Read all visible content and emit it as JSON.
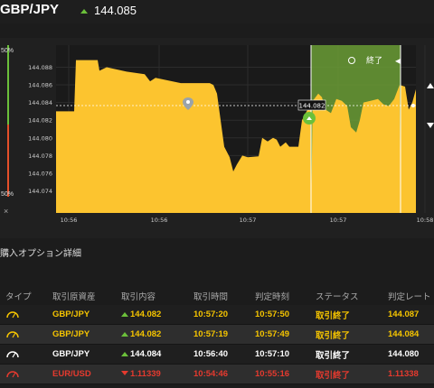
{
  "header": {
    "pair": "GBP/JPY",
    "price": "144.085",
    "trend": "up"
  },
  "chart": {
    "percent_top": "50%",
    "percent_bottom": "50%",
    "close_label": "終了",
    "current_price_tag": "144.082",
    "sidebar_close": "×",
    "colors": {
      "area": "#fcc42f",
      "expiry_zone": "#6b9e36",
      "up": "#6bc03a",
      "down": "#e5502a"
    }
  },
  "chart_data": {
    "type": "area",
    "title": "",
    "xlabel": "",
    "ylabel": "",
    "x_ticks": [
      "10:56",
      "10:56",
      "10:57",
      "10:57",
      "10:58"
    ],
    "y_ticks": [
      "144.088",
      "144.086",
      "144.084",
      "144.082",
      "144.080",
      "144.078",
      "144.076",
      "144.074"
    ],
    "ylim": [
      144.0715,
      144.0905
    ],
    "values": [
      144.0828,
      144.0828,
      144.0828,
      144.0828,
      144.0828,
      144.0828,
      144.0828,
      144.0828,
      144.0828,
      144.0828,
      144.0828,
      144.0828,
      144.0828,
      144.0828,
      144.0828,
      144.0828,
      144.0828,
      144.0828,
      144.0828,
      144.0882,
      144.0882,
      144.0882,
      144.0882,
      144.0882,
      144.0882,
      144.0882,
      144.0878,
      144.0878,
      144.0878,
      144.0878,
      144.0878,
      144.0878,
      144.0878,
      144.0878,
      144.0878,
      144.0878,
      144.0878,
      144.0878,
      144.0878,
      144.0878,
      144.0878,
      144.0878,
      144.0878,
      144.0878,
      144.0878,
      144.0878,
      144.0878,
      144.0878,
      144.0878,
      144.0878,
      144.0878,
      144.0878,
      144.0878,
      144.0878,
      144.0878,
      144.0878,
      144.0878,
      144.0878,
      144.0878,
      144.0878,
      144.0878,
      144.0878,
      144.0878,
      144.0878,
      144.0878,
      144.0878,
      144.0878,
      144.0878,
      144.0878,
      144.0878,
      144.0878,
      144.0878,
      144.0878,
      144.0878,
      144.0878,
      144.0878,
      144.0878,
      144.0878,
      144.0878,
      144.0878,
      144.0878,
      144.0878,
      144.0878,
      144.0878,
      144.0878,
      144.0878,
      144.0878,
      144.0878,
      144.0878,
      144.0878,
      144.0878,
      144.0878,
      144.0878,
      144.0878,
      144.0878,
      144.0878,
      144.0878,
      144.0878,
      144.0878,
      144.0878,
      144.0855,
      144.0855,
      144.0855,
      144.0855,
      144.0855,
      144.0855,
      144.0855,
      144.0855,
      144.0855,
      144.0855,
      144.0855,
      144.0855,
      144.0855,
      144.0855,
      144.0855,
      144.0855,
      144.0855,
      144.0855,
      144.0855,
      144.0855,
      144.0855,
      144.0855,
      144.0855,
      144.0855,
      144.0855,
      144.0855,
      144.0855,
      144.0855,
      144.0855,
      144.0855,
      144.0855,
      144.0855,
      144.0855,
      144.0855,
      144.0855,
      144.0855,
      144.0855,
      144.0855,
      144.0855,
      144.0855,
      144.0855,
      144.0855,
      144.0855,
      144.0855,
      144.0855,
      144.0855,
      144.0855,
      144.0838,
      144.0838,
      144.0838,
      144.0838,
      144.0838,
      144.0838,
      144.0838,
      144.0848,
      144.0848,
      144.0848,
      144.0848,
      144.0848,
      144.0848,
      144.0848,
      144.0848,
      144.0848,
      144.0848,
      144.0848,
      144.0848,
      144.0848,
      144.0848,
      144.0848,
      144.0848,
      144.0848,
      144.0848,
      144.0848,
      144.0848,
      144.0838,
      144.0838,
      144.0838,
      144.0838,
      144.0838,
      144.0838,
      144.0838,
      144.0838,
      144.0848,
      144.0848,
      144.0848,
      144.0848,
      144.0848,
      144.0848,
      144.0848,
      144.0848,
      144.0848,
      144.0848,
      144.0848,
      144.0848,
      144.0848,
      144.0848,
      144.0848,
      144.0848,
      144.0848,
      144.0848,
      144.0848,
      144.0848,
      144.0848,
      144.0848,
      144.0848,
      144.0848,
      144.0848,
      144.0848,
      144.0848,
      144.0848,
      144.0848,
      144.0848,
      144.0848,
      144.0848,
      144.0848,
      144.0848,
      144.0848,
      144.0848,
      144.0848,
      144.0848,
      144.0848,
      144.0848,
      144.0848,
      144.0848,
      144.0848,
      144.0848,
      144.0848,
      144.0848,
      144.0848,
      144.0848,
      144.0848,
      144.0848,
      144.0848,
      144.0848,
      144.0848,
      144.0848,
      144.0848,
      144.0848,
      144.0848,
      144.0848,
      144.0848,
      144.0848,
      144.0848,
      144.0848,
      144.0848,
      144.0848,
      144.0848,
      144.0848,
      144.0848,
      144.0848,
      144.0848,
      144.0848,
      144.0848,
      144.0848,
      144.0848,
      144.0848,
      144.0848,
      144.0848,
      144.0848,
      144.0848,
      144.0848,
      144.0848,
      144.0848,
      144.0848,
      144.0848,
      144.0848,
      144.0848,
      144.0848,
      144.0848,
      144.0848,
      144.0848,
      144.0848,
      144.0848,
      144.0848,
      144.0848,
      144.0848,
      144.0848,
      144.0848,
      144.0848,
      144.0848,
      144.0848,
      144.0848,
      144.0848,
      144.0848,
      144.0848,
      144.0848,
      144.0848,
      144.0848,
      144.0848,
      144.0848,
      144.0848,
      144.0848,
      144.0848,
      144.0848,
      144.0848,
      144.0848,
      144.0848,
      144.0848,
      144.0848,
      144.0848,
      144.0848,
      144.0848,
      144.0848,
      144.0848,
      144.0848,
      144.0848,
      144.0848,
      144.0848,
      144.0848,
      144.0848,
      144.0848,
      144.0848,
      144.0848,
      144.0848,
      144.0848,
      144.0848,
      144.0848,
      144.0848,
      144.0848,
      144.0848,
      144.0848,
      144.0848,
      144.0848,
      144.0848,
      144.0848,
      144.0848,
      144.0848,
      144.0848,
      144.0848,
      144.0848,
      144.0848,
      144.0848,
      144.0848,
      144.0848,
      144.0848,
      144.0848,
      144.0848,
      144.0848,
      144.0848,
      144.0848,
      144.0848,
      144.0848,
      144.0848,
      144.0848,
      144.0848,
      144.0848,
      144.0848,
      144.0848,
      144.0848,
      144.0848,
      144.0848,
      144.0848,
      144.0848,
      144.0848
    ],
    "grid": true,
    "legend": "none"
  },
  "details": {
    "title": "購入オプション詳細"
  },
  "table": {
    "headers": [
      "タイプ",
      "取引原資産",
      "取引内容",
      "取引時間",
      "判定時刻",
      "ステータス",
      "判定レート"
    ],
    "rows": [
      {
        "asset": "GBP/JPY",
        "direction": "up",
        "content": "144.082",
        "time": "10:57:20",
        "judge": "10:57:50",
        "status": "取引終了",
        "rate": "144.087"
      },
      {
        "asset": "GBP/JPY",
        "direction": "up",
        "content": "144.082",
        "time": "10:57:19",
        "judge": "10:57:49",
        "status": "取引終了",
        "rate": "144.084"
      },
      {
        "asset": "GBP/JPY",
        "direction": "up",
        "content": "144.084",
        "time": "10:56:40",
        "judge": "10:57:10",
        "status": "取引終了",
        "rate": "144.080"
      },
      {
        "asset": "EUR/USD",
        "direction": "down",
        "content": "1.11339",
        "time": "10:54:46",
        "judge": "10:55:16",
        "status": "取引終了",
        "rate": "1.11338"
      }
    ]
  }
}
